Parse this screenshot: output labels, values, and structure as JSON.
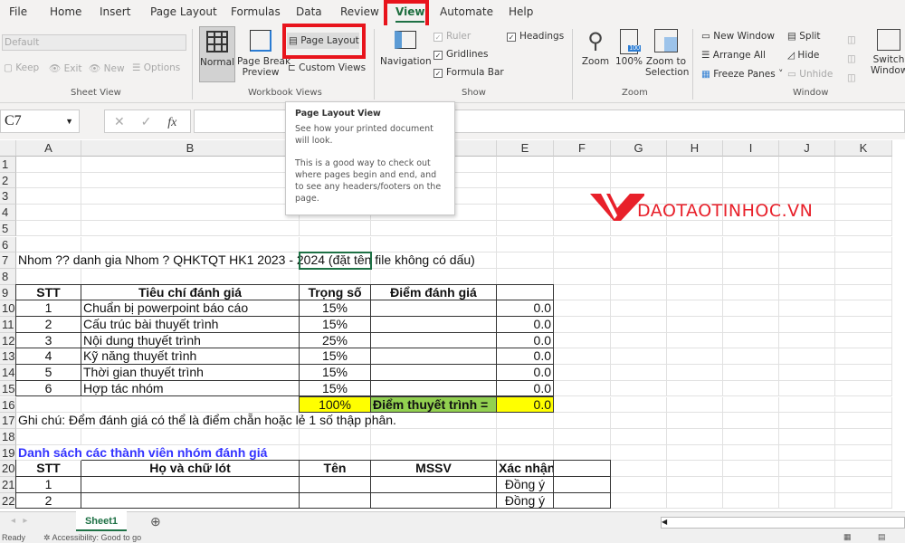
{
  "tabs": [
    "File",
    "Home",
    "Insert",
    "Page Layout",
    "Formulas",
    "Data",
    "Review",
    "View",
    "Automate",
    "Help"
  ],
  "ribbon": {
    "sheet_view": {
      "dropdown": "Default",
      "keep": "Keep",
      "exit": "Exit",
      "new": "New",
      "options": "Options",
      "group": "Sheet View"
    },
    "workbook_views": {
      "normal": "Normal",
      "page_break": "Page Break",
      "page_break2": "Preview",
      "page_layout": "Page Layout",
      "custom_views": "Custom Views",
      "group": "Workbook Views"
    },
    "show": {
      "navigation": "Navigation",
      "ruler": "Ruler",
      "gridlines": "Gridlines",
      "formula_bar": "Formula Bar",
      "headings": "Headings",
      "group": "Show"
    },
    "zoom": {
      "zoom": "Zoom",
      "hundred": "100%",
      "hundred_icon": "100",
      "to_sel": "Zoom to",
      "to_sel2": "Selection",
      "group": "Zoom"
    },
    "window": {
      "new_window": "New Window",
      "arrange_all": "Arrange All",
      "freeze_panes": "Freeze Panes",
      "split": "Split",
      "hide": "Hide",
      "unhide": "Unhide",
      "switch": "Switch",
      "switch2": "Windows",
      "group": "Window"
    }
  },
  "formula_bar": {
    "name_box": "C7",
    "fx": "fx",
    "value": ""
  },
  "tooltip": {
    "title": "Page Layout View",
    "line1": "See how your printed document will look.",
    "line2": "This is a good way to check out where pages begin and end, and to see any headers/footers on the page."
  },
  "logo": {
    "text": "DAOTAOTINHOC.VN",
    "color": "#e8202a"
  },
  "sheet": {
    "columns": [
      "A",
      "B",
      "C",
      "D",
      "E",
      "F",
      "G",
      "H",
      "I",
      "J",
      "K"
    ],
    "rows": [
      "1",
      "2",
      "3",
      "4",
      "5",
      "6",
      "7",
      "8",
      "9",
      "10",
      "11",
      "12",
      "13",
      "14",
      "15",
      "16",
      "17",
      "18",
      "19",
      "20",
      "21",
      "22"
    ],
    "cells": {
      "A7": "Nhom ?? danh gia Nhom ? QHKTQT HK1 2023 - 2024 (đặt tên file không có dấu)",
      "A9": "STT",
      "B9": "Tiêu chí đánh giá",
      "C9": "Trọng số",
      "D9": "Điểm đánh giá",
      "A10": "1",
      "B10": "Chuẩn bị powerpoint báo cáo",
      "C10": "15%",
      "E10": "0.0",
      "A11": "2",
      "B11": "Cấu trúc bài thuyết trình",
      "C11": "15%",
      "E11": "0.0",
      "A12": "3",
      "B12": "Nội dung thuyết trình",
      "C12": "25%",
      "E12": "0.0",
      "A13": "4",
      "B13": "Kỹ năng thuyết trình",
      "C13": "15%",
      "E13": "0.0",
      "A14": "5",
      "B14": "Thời gian thuyết trình",
      "C14": "15%",
      "E14": "0.0",
      "A15": "6",
      "B15": "Hợp tác nhóm",
      "C15": "15%",
      "E15": "0.0",
      "C16": "100%",
      "D16": "Điểm thuyết trình =",
      "E16": "0.0",
      "A17": "Ghi chú: Đểm đánh giá có thể là điểm chẵn hoặc lẻ 1 số thập phân.",
      "A19": "Danh sách các thành viên nhóm đánh giá",
      "A20": "STT",
      "B20": "Họ và chữ lót",
      "C20": "Tên",
      "D20": "MSSV",
      "E20": "Xác nhận",
      "A21": "1",
      "E21": "Đồng ý",
      "A22": "2",
      "E22": "Đồng ý"
    },
    "colors": {
      "yellow": "#ffff00",
      "green": "#92d050",
      "blue": "#3333ff"
    }
  },
  "sheet_tabs": {
    "active": "Sheet1"
  },
  "status": {
    "ready": "Ready",
    "accessibility": "Accessibility: Good to go"
  }
}
